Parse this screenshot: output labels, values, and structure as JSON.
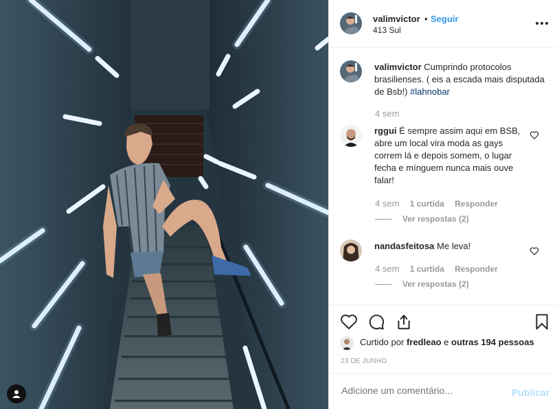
{
  "post": {
    "username": "valimvictor",
    "dot": "•",
    "follow_label": "Seguir",
    "location": "413 Sul"
  },
  "caption": {
    "username": "valimvictor",
    "text": "Cumprindo protocolos brasilienses. ( eis a escada mais disputada de Bsb!)",
    "hashtag": "#lahnobar",
    "time": "4 sem"
  },
  "comments": [
    {
      "username": "rggui",
      "text": "É sempre assim aqui em BSB, abre um local vira moda as gays correm lá e depois somem, o lugar fecha e mínguem nunca mais ouve falar!",
      "time": "4 sem",
      "likes": "1 curtida",
      "reply": "Responder",
      "view_replies": "Ver respostas (2)"
    },
    {
      "username": "nandasfeitosa",
      "text": "Me leva!",
      "time": "4 sem",
      "likes": "1 curtida",
      "reply": "Responder",
      "view_replies": "Ver respostas (2)"
    }
  ],
  "likes": {
    "prefix": "Curtido por",
    "user": "fredleao",
    "middle": "e",
    "others": "outras 194 pessoas"
  },
  "date": "23 DE JUNHO",
  "add_comment": {
    "placeholder": "Adicione um comentário...",
    "post_label": "Publicar"
  },
  "icons": {
    "more": "more-horizontal-icon",
    "heart": "heart-icon",
    "comment": "comment-icon",
    "share": "share-icon",
    "save": "bookmark-icon",
    "user_tag": "user-tag-icon"
  },
  "colors": {
    "link": "#3897f0",
    "hashtag": "#003569",
    "muted": "#999999",
    "publish_disabled": "#b2dffc"
  }
}
